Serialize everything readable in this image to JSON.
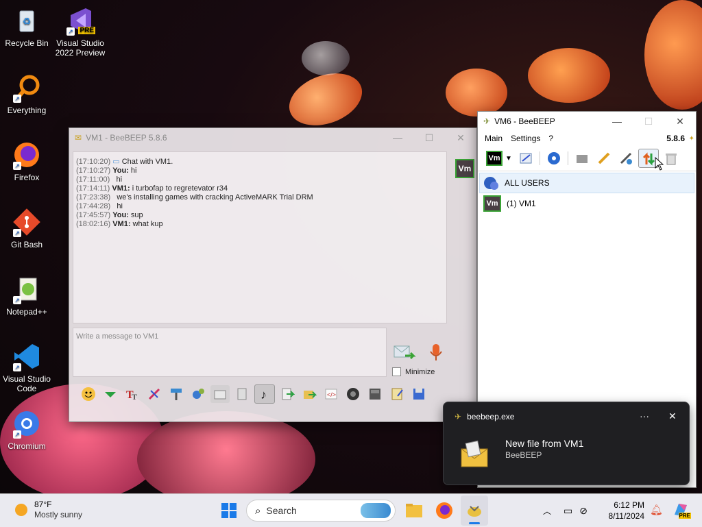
{
  "desktop": {
    "icons": [
      {
        "label": "Recycle Bin"
      },
      {
        "label": "Visual Studio\n2022 Preview",
        "badge": "PRE"
      },
      {
        "label": "Everything"
      },
      {
        "label": "Firefox"
      },
      {
        "label": "Git Bash"
      },
      {
        "label": "Notepad++"
      },
      {
        "label": "Visual Studio\nCode"
      },
      {
        "label": "Chromium"
      }
    ]
  },
  "chat_window": {
    "title": "VM1 - BeeBEEP 5.8.6",
    "avatar": "Vm",
    "messages": [
      {
        "time": "(17:10:20)",
        "sender": "",
        "text": "Chat with VM1."
      },
      {
        "time": "(17:10:27)",
        "sender": "You:",
        "text": "hi"
      },
      {
        "time": "(17:11:00)",
        "sender": "",
        "text": "hi"
      },
      {
        "time": "(17:14:11)",
        "sender": "VM1:",
        "text": "i turbofap to regretevator r34"
      },
      {
        "time": "(17:23:38)",
        "sender": "",
        "text": "we's installing games with cracking ActiveMARK Trial DRM"
      },
      {
        "time": "(17:44:28)",
        "sender": "",
        "text": "hi"
      },
      {
        "time": "(17:45:57)",
        "sender": "You:",
        "text": "sup"
      },
      {
        "time": "(18:02:16)",
        "sender": "VM1:",
        "text": "what kup"
      }
    ],
    "input_placeholder": "Write a message to VM1",
    "minimize_label": "Minimize"
  },
  "main_window": {
    "title": "VM6 - BeeBEEP",
    "menu": [
      "Main",
      "Settings",
      "?"
    ],
    "version": "5.8.6",
    "avatar": "Vm",
    "users": [
      {
        "label": "ALL USERS"
      },
      {
        "label": "(1) VM1",
        "avatar": "Vm"
      }
    ]
  },
  "notification": {
    "app": "beebeep.exe",
    "title": "New file from VM1",
    "subtitle": "BeeBEEP",
    "more": "···",
    "close": "✕"
  },
  "taskbar": {
    "weather_temp": "87°F",
    "weather_desc": "Mostly sunny",
    "search_label": "Search",
    "time": "6:12 PM",
    "date": "8/11/2024",
    "copilot_badge": "PRE"
  },
  "colors": {
    "accent": "#3aa335",
    "avatar_bg": "#4a3f44"
  }
}
